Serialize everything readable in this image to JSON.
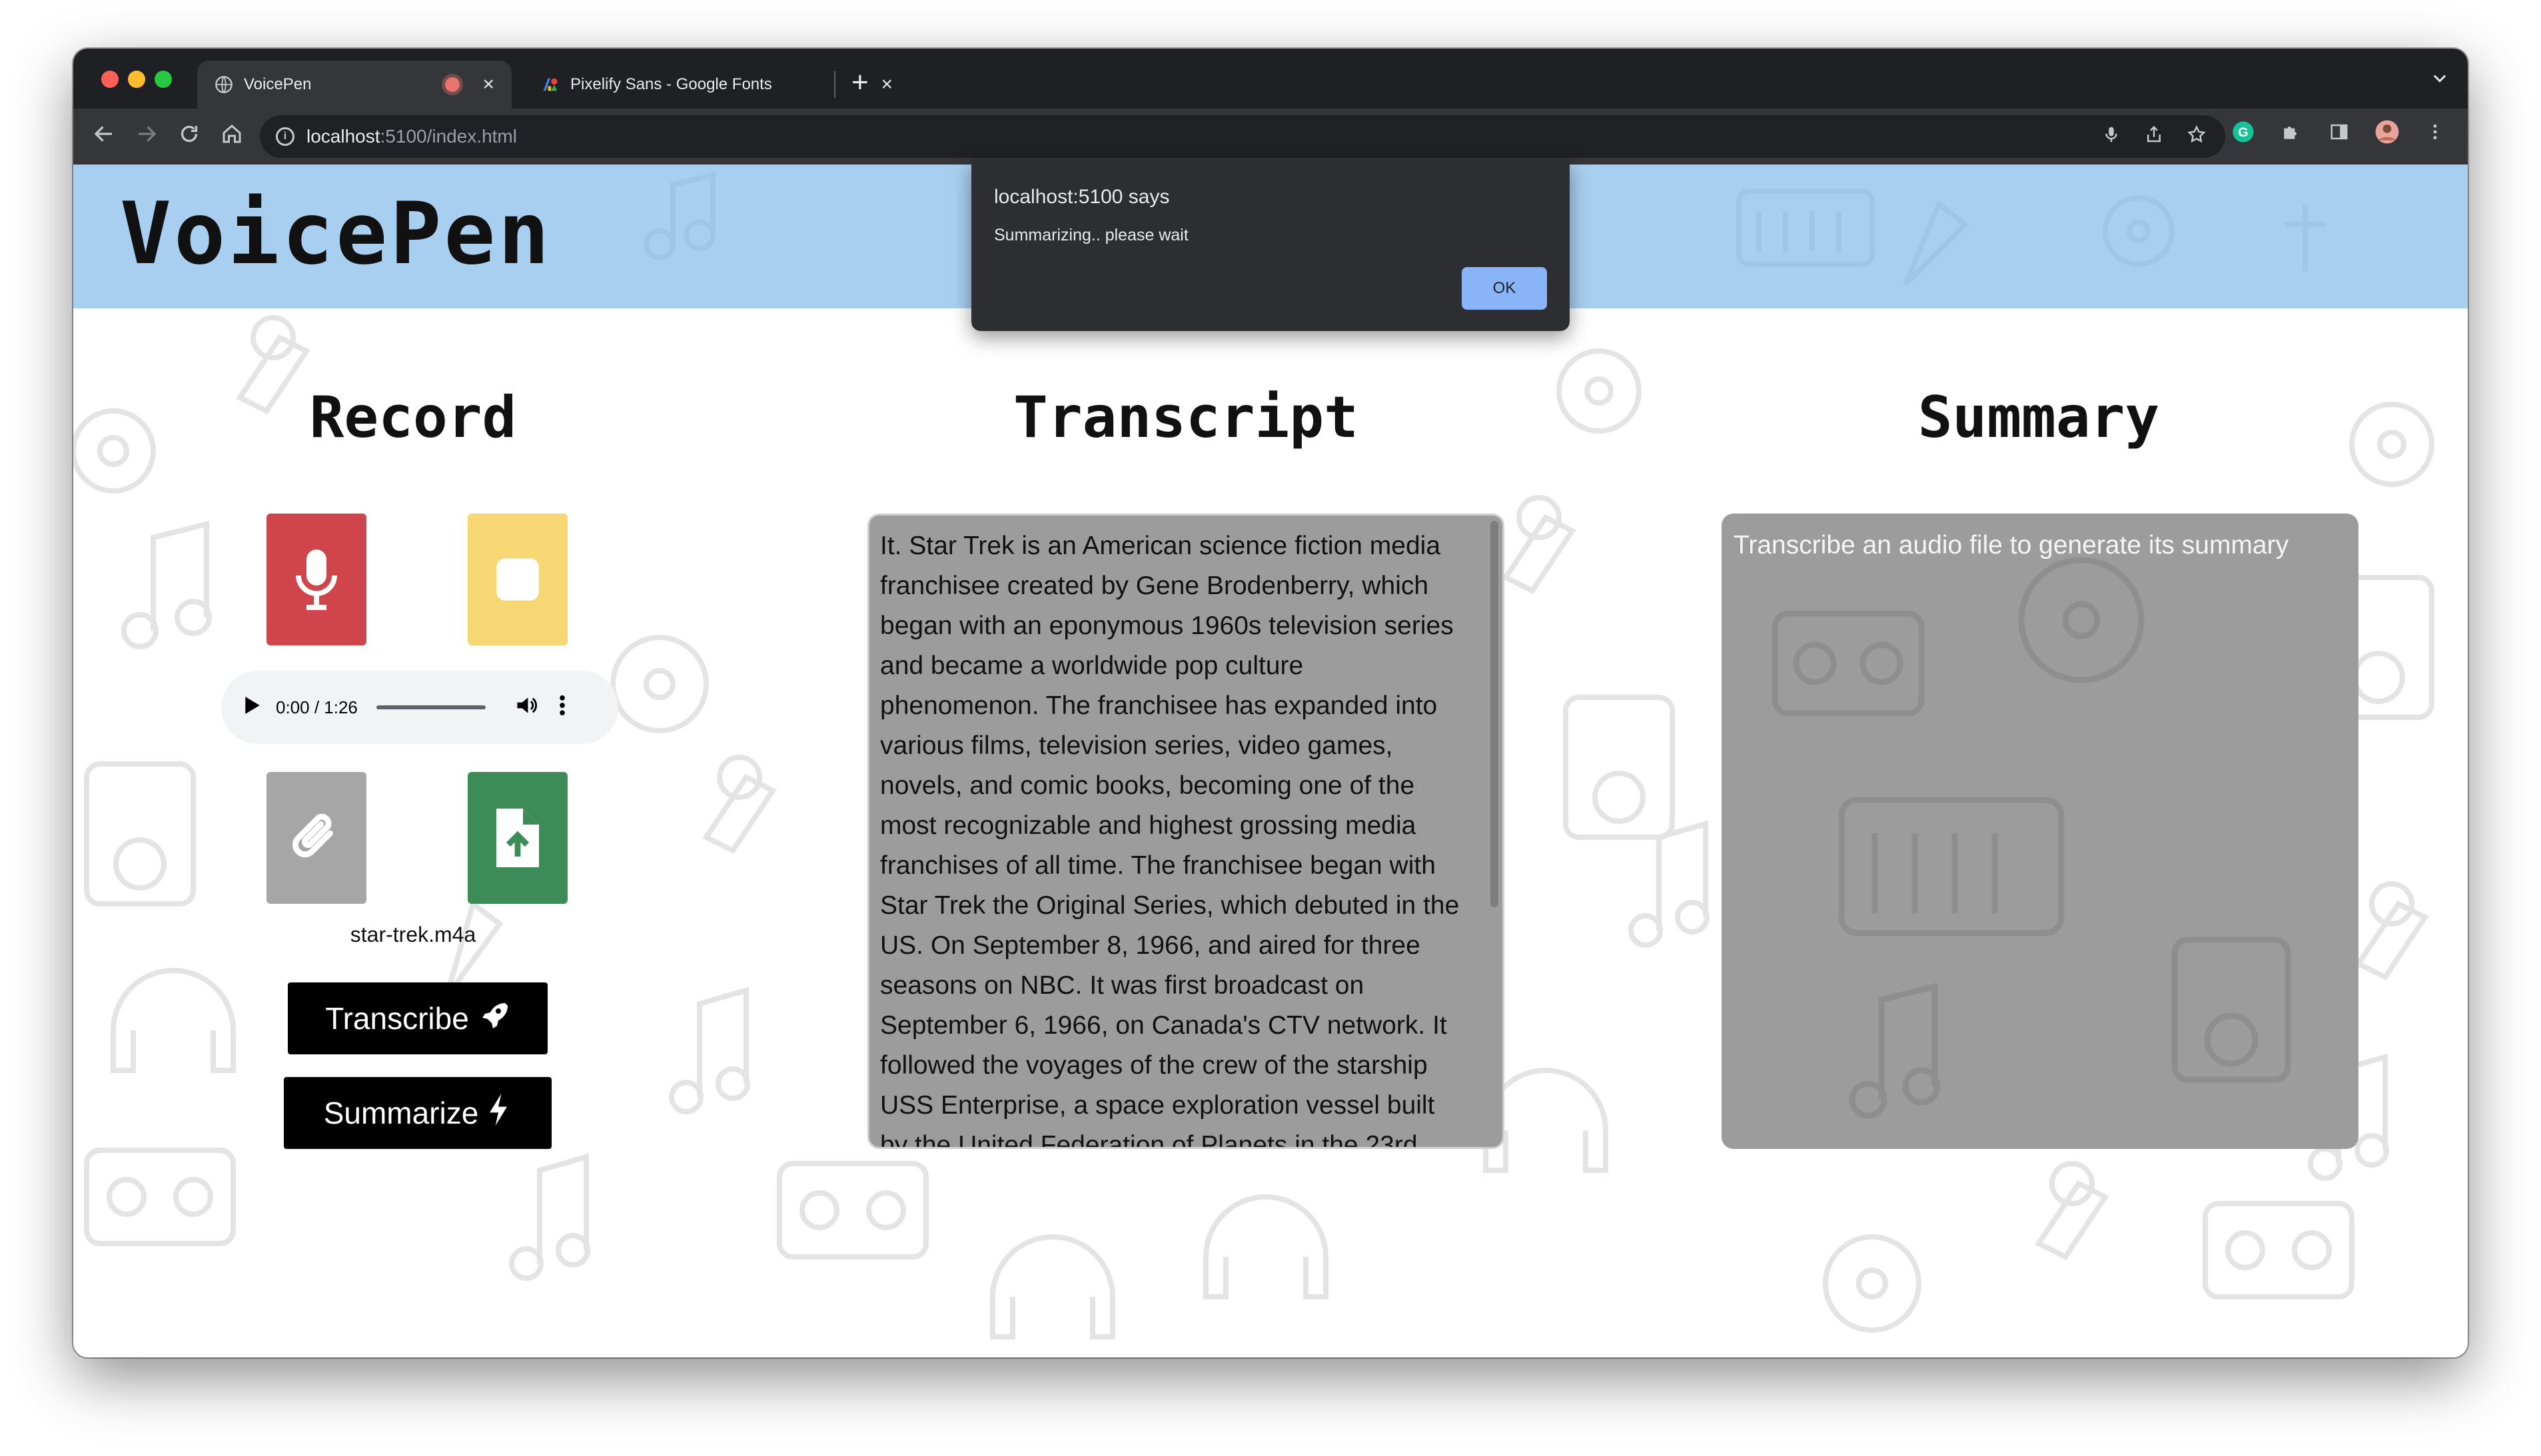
{
  "browser": {
    "tabs": [
      {
        "title": "VoicePen",
        "active": true
      },
      {
        "title": "Pixelify Sans - Google Fonts",
        "active": false
      }
    ],
    "new_tab": "+",
    "close_symbol": "×",
    "url_host": "localhost",
    "url_path": ":5100/index.html"
  },
  "app": {
    "brand": "VoicePen",
    "columns": {
      "record": "Record",
      "transcript": "Transcript",
      "summary": "Summary"
    },
    "audio": {
      "time": "0:00 / 1:26",
      "progress": 0.0
    },
    "filename": "star-trek.m4a",
    "transcribe_label": "Transcribe",
    "summarize_label": "Summarize",
    "transcript_text": "It. Star Trek is an American science fiction media franchisee created by Gene Brodenberry, which began with an eponymous 1960s television series and became a worldwide pop culture phenomenon. The franchisee has expanded into various films, television series, video games, novels, and comic books, becoming one of the most recognizable and highest grossing media franchises of all time. The franchisee began with Star Trek the Original Series, which debuted in the US. On September 8, 1966, and aired for three seasons on NBC. It was first broadcast on September 6, 1966, on Canada's CTV network. It followed the voyages of the crew of the starship USS Enterprise, a space exploration vessel built by the United Federation of Planets in the 23rd",
    "summary_placeholder": "Transcribe an audio file to generate its summary"
  },
  "dialog": {
    "title": "localhost:5100 says",
    "message": "Summarizing.. please wait",
    "ok_label": "OK"
  },
  "colors": {
    "header_bg": "#a9cff0",
    "record_button": "#d0454c",
    "stop_button": "#f7d774",
    "attach_button": "#a6a6a6",
    "upload_button": "#3d8b57",
    "panel_bg": "#9c9c9c",
    "ok_button": "#8ab4f8"
  }
}
